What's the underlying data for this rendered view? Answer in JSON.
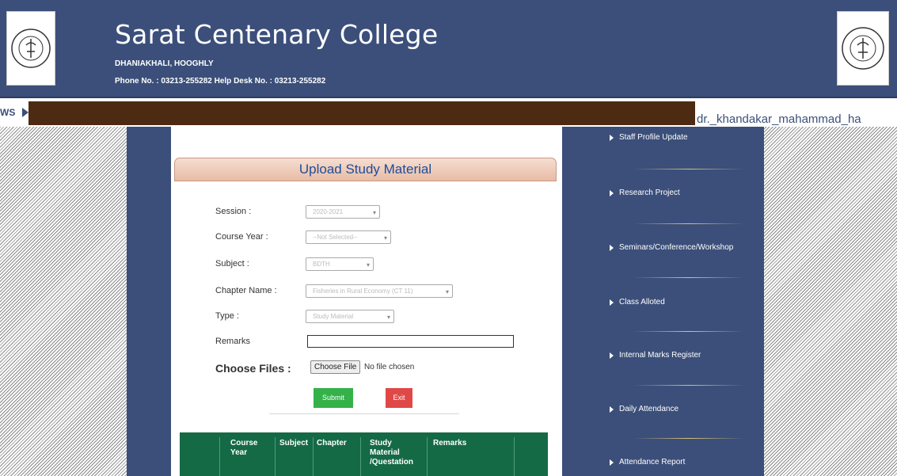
{
  "header": {
    "college_name": "Sarat Centenary College",
    "address": "DHANIAKHALI, HOOGHLY",
    "phone_line": "Phone No. : 03213-255282  Help Desk No. : 03213-255282",
    "logo_icon": "college-seal-icon"
  },
  "newsbar": {
    "label": "WS",
    "user": "dr._khandakar_mahammad_ha"
  },
  "form": {
    "title": "Upload Study Material",
    "session_label": "Session :",
    "session_value": "2020-2021",
    "course_year_label": "Course Year :",
    "course_year_value": "--Not Selected--",
    "subject_label": "Subject :",
    "subject_value": "BDTH",
    "chapter_label": "Chapter Name :",
    "chapter_value": "Fisheries in Rural Economy (CT 11)",
    "type_label": "Type :",
    "type_value": "Study Material",
    "remarks_label": "Remarks",
    "remarks_value": "",
    "choose_files_label": "Choose Files :",
    "choose_file_button": "Choose File",
    "no_file_text": "No file chosen",
    "submit_label": "Submit",
    "exit_label": "Exit"
  },
  "table": {
    "headers": [
      "Course Year",
      "Subject",
      "Chapter",
      "Study Material /Questation",
      "Remarks"
    ]
  },
  "menu": {
    "items": [
      "Staff Profile Update",
      "Research Project",
      "Seminars/Conference/Workshop",
      "Class Alloted",
      "Internal Marks Register",
      "Daily Attendance",
      "Attendance Report"
    ]
  },
  "colors": {
    "header_bg": "#3b4f7a",
    "news_ticker": "#4d2a12",
    "title_text": "#1e4c9a",
    "table_header": "#156a46",
    "submit": "#35b14a",
    "exit": "#e04848"
  }
}
